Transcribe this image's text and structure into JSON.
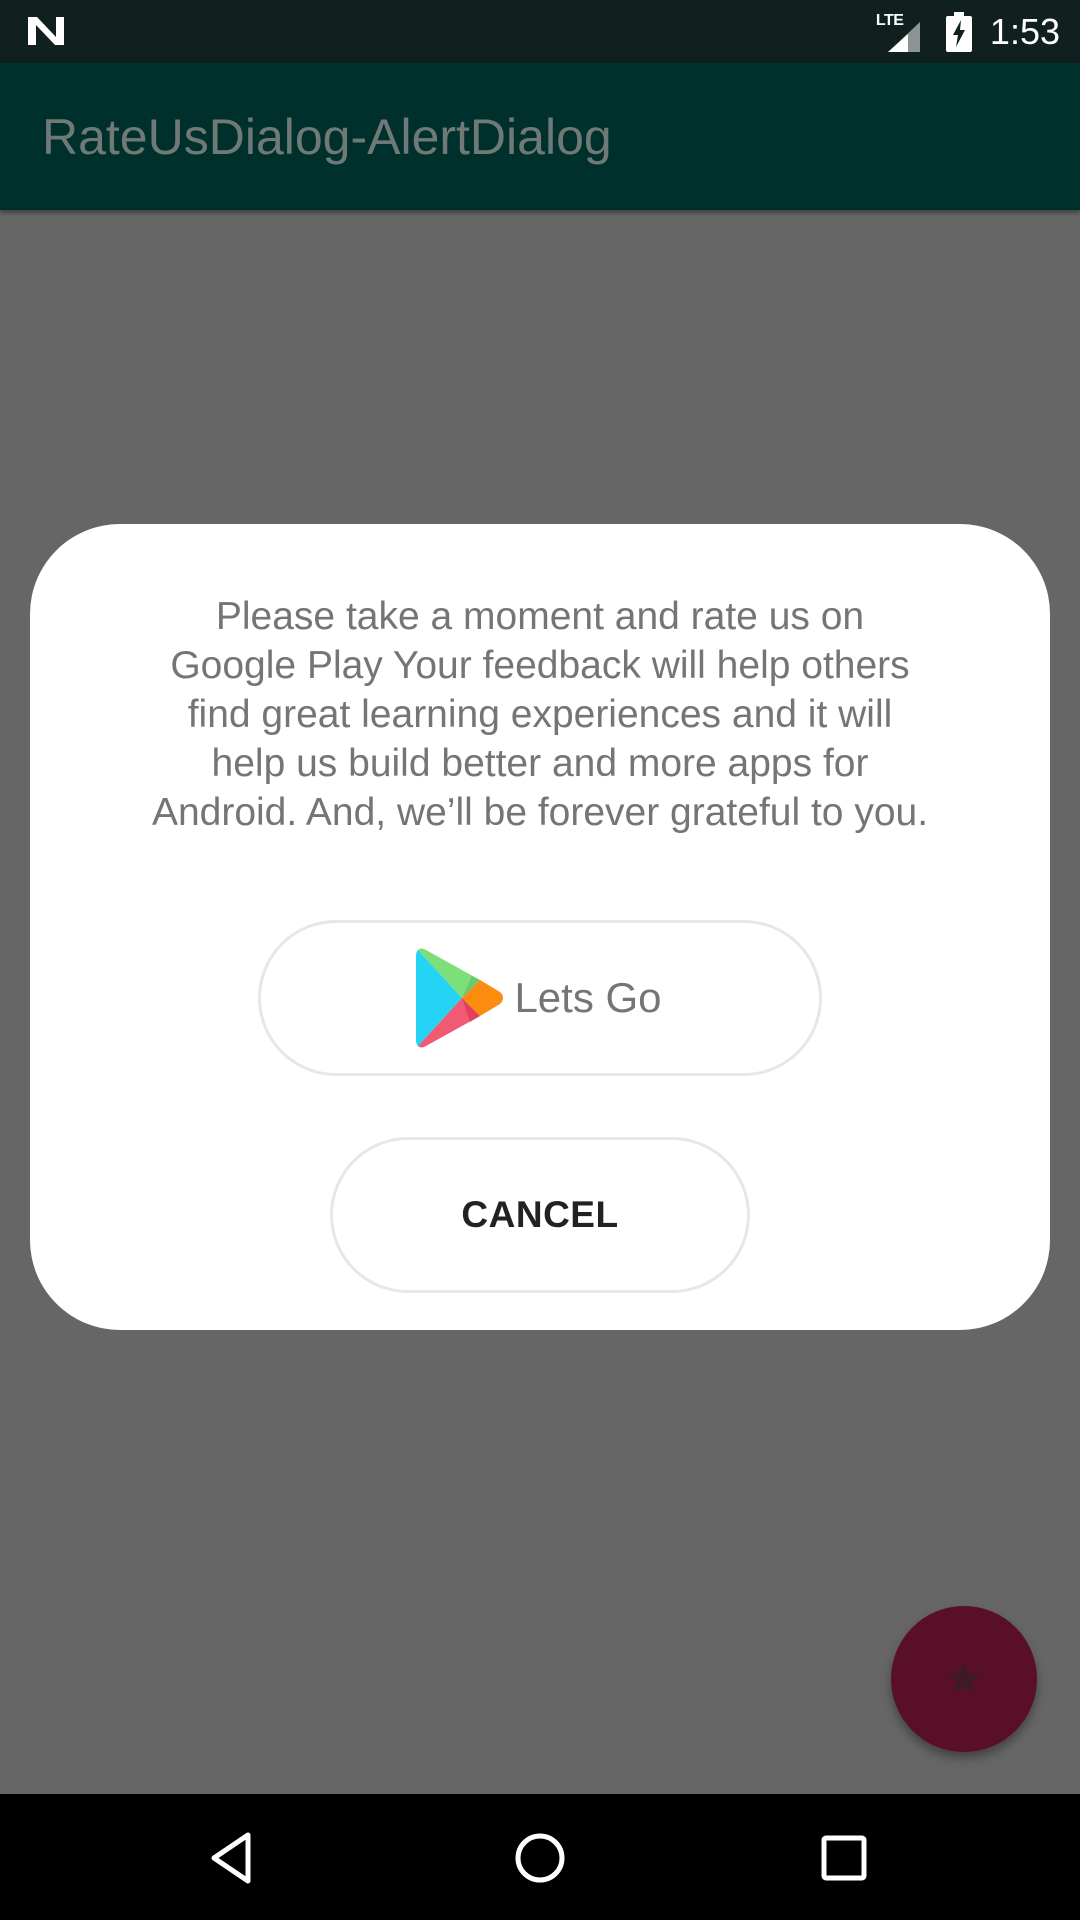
{
  "status_bar": {
    "network_label": "LTE",
    "time": "1:53",
    "icons": [
      "n-logo-icon",
      "lte-signal-icon",
      "battery-charging-icon"
    ]
  },
  "app_bar": {
    "title": "RateUsDialog-AlertDialog"
  },
  "dialog": {
    "message": "Please take a moment and rate us on Google Play Your feedback will help others find great learning experiences and it will help us build better and more apps for Android. And, we’ll be forever grateful to you.",
    "primary_button": {
      "label": "Lets Go",
      "icon": "google-play-icon"
    },
    "cancel_button": {
      "label": "CANCEL"
    }
  },
  "fab": {
    "icon": "star-icon"
  },
  "nav_bar": {
    "buttons": [
      "back-icon",
      "home-icon",
      "recents-icon"
    ]
  },
  "colors": {
    "scrim_background": "#666666",
    "status_bar": "#0f201f",
    "app_bar_dimmed": "#00302c",
    "fab_dimmed": "#5a0f28",
    "dialog_background": "#ffffff",
    "message_text": "#757575"
  }
}
